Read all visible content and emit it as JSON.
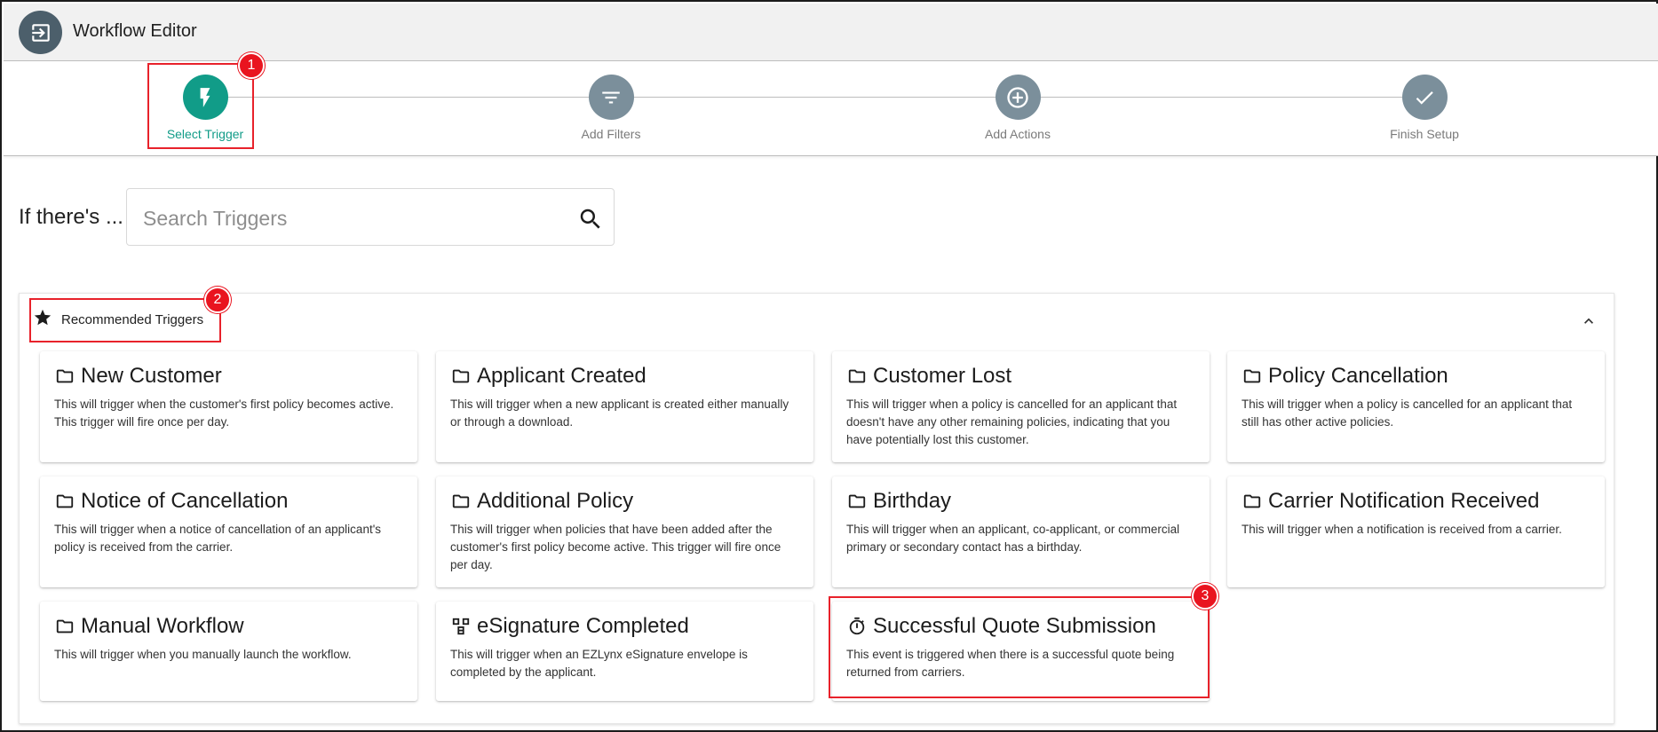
{
  "header": {
    "title": "Workflow Editor",
    "icon": "exit-to-app-icon"
  },
  "stepper": {
    "steps": [
      {
        "label": "Select Trigger",
        "icon": "bolt-icon",
        "active": true
      },
      {
        "label": "Add Filters",
        "icon": "filter-icon",
        "active": false
      },
      {
        "label": "Add Actions",
        "icon": "plus-circle-icon",
        "active": false
      },
      {
        "label": "Finish Setup",
        "icon": "check-icon",
        "active": false
      }
    ]
  },
  "search": {
    "prefix": "If there's ...",
    "placeholder": "Search Triggers",
    "value": ""
  },
  "recommended": {
    "title": "Recommended Triggers",
    "cards": [
      {
        "icon": "folder-icon",
        "title": "New Customer",
        "desc": "This will trigger when the customer's first policy becomes active. This trigger will fire once per day."
      },
      {
        "icon": "folder-icon",
        "title": "Applicant Created",
        "desc": "This will trigger when a new applicant is created either manually or through a download."
      },
      {
        "icon": "folder-icon",
        "title": "Customer Lost",
        "desc": "This will trigger when a policy is cancelled for an applicant that doesn't have any other remaining policies, indicating that you have potentially lost this customer."
      },
      {
        "icon": "folder-icon",
        "title": "Policy Cancellation",
        "desc": "This will trigger when a policy is cancelled for an applicant that still has other active policies."
      },
      {
        "icon": "folder-icon",
        "title": "Notice of Cancellation",
        "desc": "This will trigger when a notice of cancellation of an applicant's policy is received from the carrier."
      },
      {
        "icon": "folder-icon",
        "title": "Additional Policy",
        "desc": "This will trigger when policies that have been added after the customer's first policy become active. This trigger will fire once per day."
      },
      {
        "icon": "folder-icon",
        "title": "Birthday",
        "desc": "This will trigger when an applicant, co-applicant, or commercial primary or secondary contact has a birthday."
      },
      {
        "icon": "folder-icon",
        "title": "Carrier Notification Received",
        "desc": "This will trigger when a notification is received from a carrier."
      },
      {
        "icon": "folder-icon",
        "title": "Manual Workflow",
        "desc": "This will trigger when you manually launch the workflow."
      },
      {
        "icon": "esignature-icon",
        "title": "eSignature Completed",
        "desc": "This will trigger when an EZLynx eSignature envelope is completed by the applicant."
      },
      {
        "icon": "timer-icon",
        "title": "Successful Quote Submission",
        "desc": "This event is triggered when there is a successful quote being returned from carriers."
      }
    ]
  },
  "annotations": {
    "badge1": "1",
    "badge2": "2",
    "badge3": "3"
  },
  "colors": {
    "accent": "#119c88",
    "step_inactive": "#7b8f9b",
    "highlight": "#e8222b"
  }
}
